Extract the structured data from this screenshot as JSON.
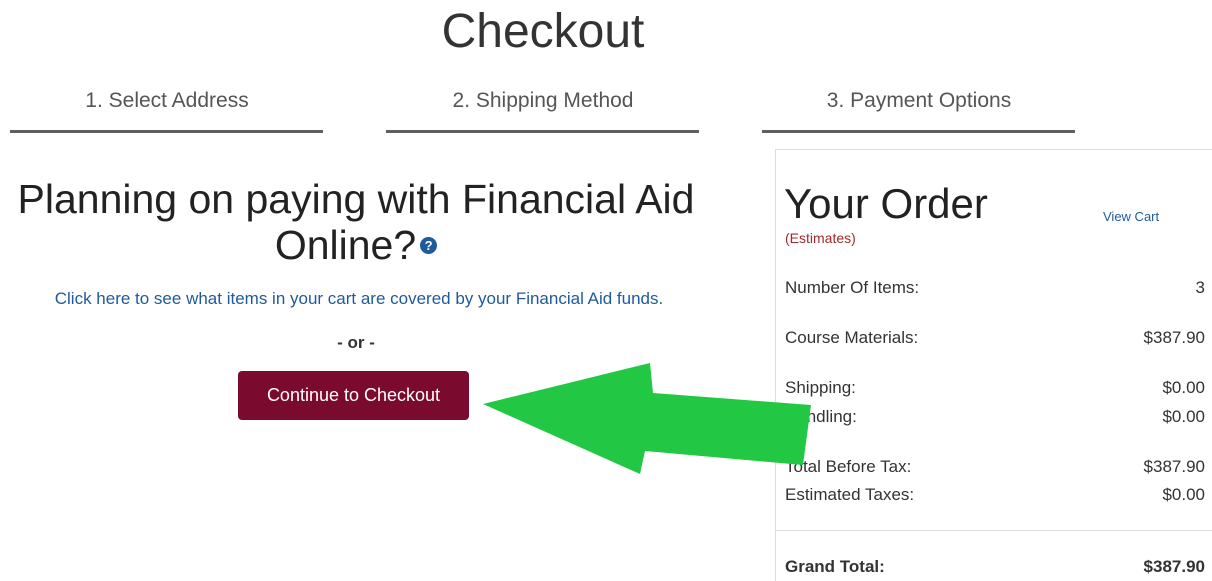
{
  "header": {
    "title": "Checkout"
  },
  "steps": [
    {
      "label": "1. Select Address"
    },
    {
      "label": "2. Shipping Method"
    },
    {
      "label": "3. Payment Options"
    }
  ],
  "financial_aid": {
    "title_line1": "Planning on paying with Financial Aid",
    "title_line2": "Online?",
    "help_icon": "question-circle-icon",
    "help_glyph": "?",
    "link_text": "Click here to see what items in your cart are covered by your Financial Aid funds.",
    "or_text": "- or -",
    "continue_label": "Continue to Checkout"
  },
  "order": {
    "title": "Your Order",
    "estimates": "(Estimates)",
    "view_cart": "View Cart",
    "rows": [
      {
        "label": "Number Of Items:",
        "value": "3"
      },
      {
        "label": "Course Materials:",
        "value": "$387.90"
      },
      {
        "label": "Shipping:",
        "value": "$0.00"
      },
      {
        "label": "Handling:",
        "value": "$0.00"
      },
      {
        "label": "Total Before Tax:",
        "value": "$387.90"
      },
      {
        "label": "Estimated Taxes:",
        "value": "$0.00"
      }
    ],
    "grand_total_label": "Grand Total:",
    "grand_total_value": "$387.90"
  },
  "colors": {
    "button_bg": "#7a0a2e",
    "link": "#1f5a9c",
    "estimates": "#a32a2a",
    "arrow": "#22c844"
  }
}
